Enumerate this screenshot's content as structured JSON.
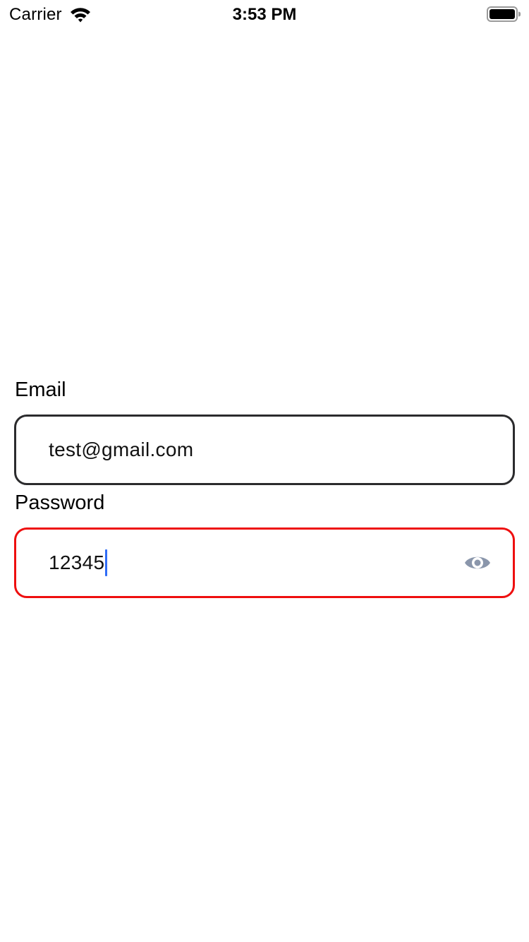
{
  "status_bar": {
    "carrier": "Carrier",
    "time": "3:53 PM",
    "icons": [
      "wifi-icon",
      "battery-icon"
    ]
  },
  "form": {
    "email": {
      "label": "Email",
      "value": "test@gmail.com"
    },
    "password": {
      "label": "Password",
      "value": "12345",
      "toggle_icon": "eye-icon",
      "state": "error"
    }
  },
  "colors": {
    "background": "#ffffff",
    "field_border": "#2b2b2d",
    "error_border": "#ee0f0f",
    "caret": "#2f6cf6",
    "eye_icon": "#8a96ab"
  }
}
